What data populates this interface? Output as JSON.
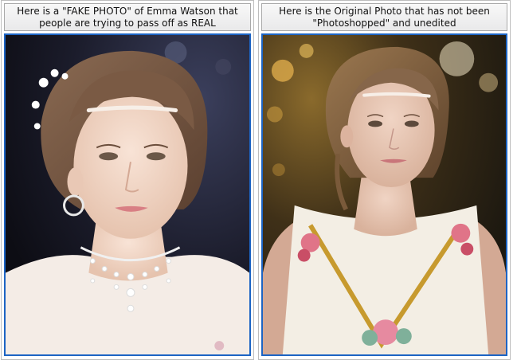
{
  "panels": [
    {
      "caption": "Here is a \"FAKE PHOTO\" of Emma Watson that people are trying to pass off as REAL",
      "caption_line1": "Here is a \"FAKE PHOTO\" of Emma Watson that",
      "caption_line2": "people are trying to pass off as REAL"
    },
    {
      "caption": "Here is the Original Photo that has not been \"Photoshopped\" and unedited",
      "caption_line1": "Here is the Original Photo that has not been",
      "caption_line2": "\"Photoshopped\" and unedited"
    }
  ],
  "colors": {
    "frame_border": "#1c64c4",
    "caption_bg": "#ededed",
    "left_background": "#1a1a2a",
    "right_background": "#3a2d1a"
  }
}
